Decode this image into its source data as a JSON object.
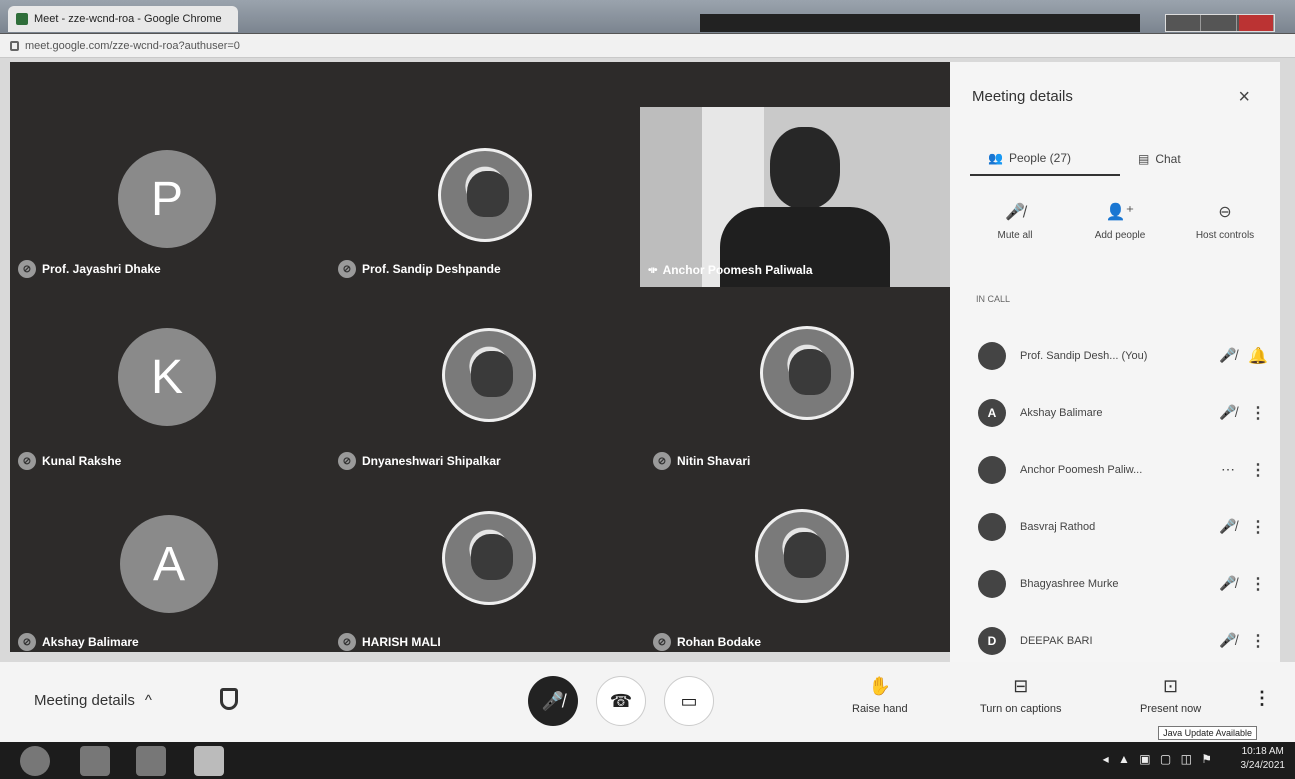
{
  "window": {
    "tab_title": "Meet - zze-wcnd-roa - Google Chrome",
    "url": "meet.google.com/zze-wcnd-roa?authuser=0"
  },
  "tiles": [
    {
      "name": "Prof. Jayashri Dhake",
      "letter": "P"
    },
    {
      "name": "Prof. Sandip Deshpande",
      "letter": ""
    },
    {
      "name": "Anchor Poomesh Paliwala",
      "letter": ""
    },
    {
      "name": "Kunal Rakshe",
      "letter": "K"
    },
    {
      "name": "Dnyaneshwari Shipalkar",
      "letter": ""
    },
    {
      "name": "Nitin Shavari",
      "letter": ""
    },
    {
      "name": "Akshay Balimare",
      "letter": "A"
    },
    {
      "name": "HARISH MALI",
      "letter": ""
    },
    {
      "name": "Rohan Bodake",
      "letter": ""
    }
  ],
  "panel": {
    "title": "Meeting details",
    "close": "×",
    "tabs": [
      {
        "label": "People (27)"
      },
      {
        "label": "Chat"
      }
    ],
    "actions": [
      {
        "label": "Mute all"
      },
      {
        "label": "Add people"
      },
      {
        "label": "Host controls"
      }
    ],
    "section": "IN CALL",
    "people": [
      {
        "avatar": "",
        "name": "Prof. Sandip Desh...  (You)",
        "status": "🎤̸",
        "more": "🔔"
      },
      {
        "avatar": "A",
        "name": "Akshay Balimare",
        "status": "🎤̸",
        "more": "⋮"
      },
      {
        "avatar": "",
        "name": "Anchor Poomesh Paliw...",
        "status": "⋯",
        "more": "⋮"
      },
      {
        "avatar": "",
        "name": "Basvraj Rathod",
        "status": "🎤̸",
        "more": "⋮"
      },
      {
        "avatar": "",
        "name": "Bhagyashree Murke",
        "status": "🎤̸",
        "more": "⋮"
      },
      {
        "avatar": "D",
        "name": "DEEPAK BARI",
        "status": "🎤̸",
        "more": "⋮"
      }
    ]
  },
  "bottom": {
    "meeting_details": "Meeting details",
    "chevron": "^",
    "raise_hand": "Raise hand",
    "captions": "Turn on captions",
    "present": "Present now",
    "java_update": "Java Update Available"
  },
  "taskbar": {
    "time": "10:18 AM",
    "date": "3/24/2021"
  }
}
